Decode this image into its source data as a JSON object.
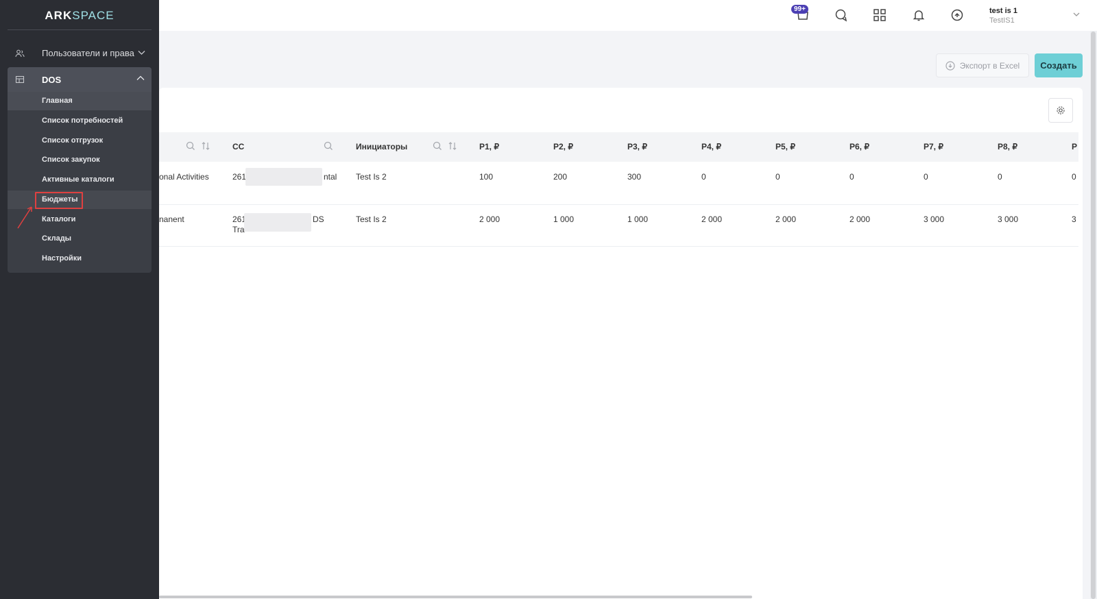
{
  "brand": {
    "left": "ARK",
    "right": "SPACE"
  },
  "sidebar": {
    "users_section": "Пользователи и права",
    "dos_section": "DOS",
    "items": [
      "Главная",
      "Список потребностей",
      "Список отгрузок",
      "Список закупок",
      "Активные каталоги",
      "Бюджеты",
      "Каталоги",
      "Склады",
      "Настройки"
    ],
    "selected": "Бюджеты"
  },
  "topbar": {
    "cart_badge": "99+",
    "user_name": "test is 1",
    "user_login": "TestIS1"
  },
  "actions": {
    "export_label": "Экспорт в Excel",
    "create_label": "Создать"
  },
  "table": {
    "headers": [
      "CC",
      "Инициаторы",
      "P1, ₽",
      "P2, ₽",
      "P3, ₽",
      "P4, ₽",
      "P5, ₽",
      "P6, ₽",
      "P7, ₽",
      "P8, ₽",
      "P"
    ],
    "rows": [
      {
        "col1": "onal Activities",
        "cc_a": "261",
        "cc_b": "ntal",
        "initiator": "Test Is 2",
        "p": [
          "100",
          "200",
          "300",
          "0",
          "0",
          "0",
          "0",
          "0",
          "0"
        ]
      },
      {
        "col1": "nanent",
        "cc_a": "261",
        "cc_b": "DS",
        "cc_c": "Tra",
        "initiator": "Test Is 2",
        "p": [
          "2 000",
          "1 000",
          "1 000",
          "2 000",
          "2 000",
          "2 000",
          "3 000",
          "3 000",
          "3"
        ]
      }
    ]
  },
  "colors": {
    "sidebar_bg": "#2b2d33",
    "accent": "#6ecfd6",
    "badge": "#4b3fb3",
    "highlight_box": "#e04040"
  }
}
